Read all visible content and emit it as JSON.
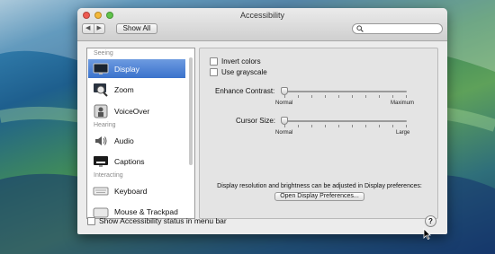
{
  "window": {
    "title": "Accessibility"
  },
  "toolbar": {
    "show_all": "Show All",
    "back_icon": "chevron-left-icon",
    "forward_icon": "chevron-right-icon",
    "search_placeholder": ""
  },
  "sidebar": {
    "sections": {
      "seeing": "Seeing",
      "hearing": "Hearing",
      "interacting": "Interacting"
    },
    "items": [
      {
        "label": "Display",
        "icon": "display-icon",
        "selected": true
      },
      {
        "label": "Zoom",
        "icon": "zoom-icon",
        "selected": false
      },
      {
        "label": "VoiceOver",
        "icon": "voiceover-icon",
        "selected": false
      },
      {
        "label": "Audio",
        "icon": "speaker-icon",
        "selected": false
      },
      {
        "label": "Captions",
        "icon": "captions-icon",
        "selected": false
      },
      {
        "label": "Keyboard",
        "icon": "keyboard-icon",
        "selected": false
      },
      {
        "label": "Mouse & Trackpad",
        "icon": "mouse-icon",
        "selected": false
      }
    ]
  },
  "display": {
    "invert_colors": {
      "label": "Invert colors",
      "checked": false
    },
    "use_grayscale": {
      "label": "Use grayscale",
      "checked": false
    },
    "enhance_contrast": {
      "label": "Enhance Contrast:",
      "min_label": "Normal",
      "max_label": "Maximum",
      "value": 0
    },
    "cursor_size": {
      "label": "Cursor Size:",
      "min_label": "Normal",
      "max_label": "Large",
      "value": 0
    },
    "note": "Display resolution and brightness can be adjusted in Display preferences:",
    "open_button": "Open Display Preferences..."
  },
  "footer": {
    "status_checkbox": "Show Accessibility status in menu bar",
    "status_checked": false,
    "help": "?"
  },
  "colors": {
    "selection": "#3a72cc",
    "window_bg": "#ececec"
  }
}
